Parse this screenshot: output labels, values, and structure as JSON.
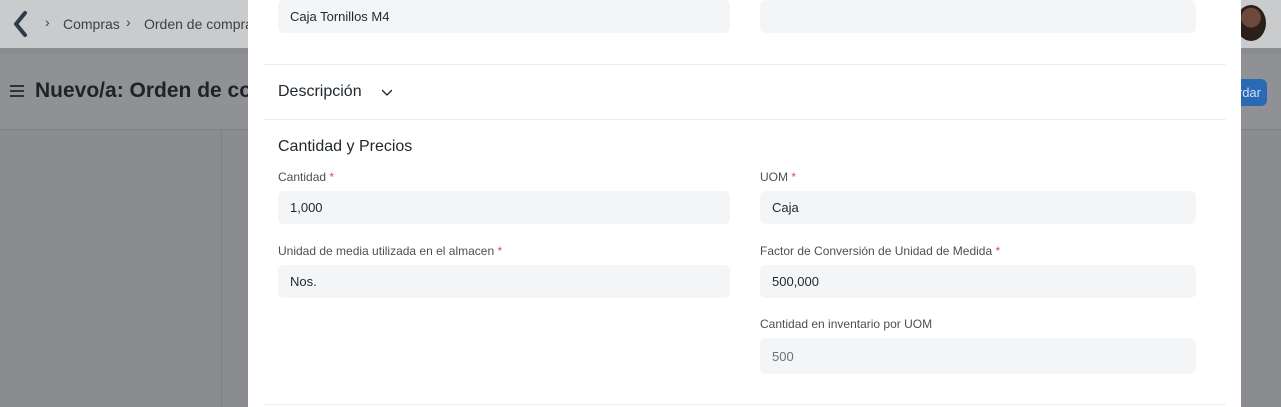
{
  "breadcrumb": {
    "items": [
      "Compras",
      "Orden de compra"
    ]
  },
  "page": {
    "title": "Nuevo/a: Orden de compra",
    "save_label": "Guardar"
  },
  "modal": {
    "item_name_value": "Caja Tornillos M4",
    "item_right_value": "",
    "description_section": "Descripción",
    "qty_section": "Cantidad y Precios",
    "fields": {
      "cantidad": {
        "label": "Cantidad",
        "value": "1,000"
      },
      "uom": {
        "label": "UOM",
        "value": "Caja"
      },
      "stock_uom": {
        "label": "Unidad de media utilizada en el almacen",
        "value": "Nos."
      },
      "conversion": {
        "label": "Factor de Conversión de Unidad de Medida",
        "value": "500,000"
      },
      "stock_qty": {
        "label": "Cantidad en inventario por UOM",
        "value": "500"
      }
    },
    "required_marker": "*"
  },
  "colors": {
    "accent": "#2490ef",
    "required": "#e24c4c",
    "field_bg": "#f4f5f6"
  },
  "icons": [
    "app-logo-icon",
    "breadcrumb-chevron-icon",
    "hamburger-icon",
    "chevron-down-icon",
    "avatar"
  ]
}
